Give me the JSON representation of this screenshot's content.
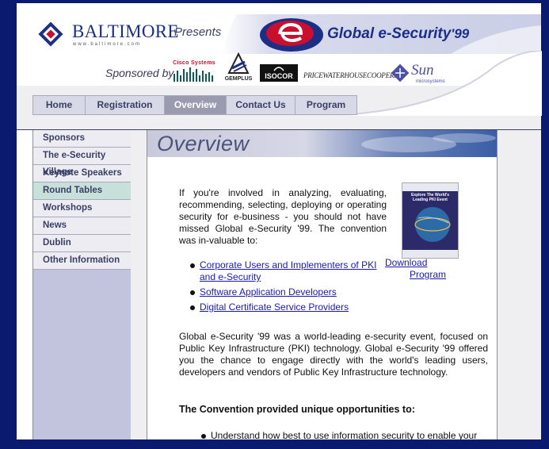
{
  "brand": {
    "name": "BALTIMORE",
    "url_text": "www.baltimore.com",
    "presents": "Presents",
    "event_title": "Global e-Security",
    "event_year": "'99",
    "brand_blue": "#1c2f86",
    "brand_red": "#c8102e"
  },
  "sponsors": {
    "label": "Sponsored by",
    "names": [
      "Cisco Systems",
      "GEMPLUS",
      "ISOCOR",
      "PRICEWATERHOUSECOOPERS",
      "Sun",
      "microsystems"
    ]
  },
  "nav": {
    "items": [
      {
        "label": "Home",
        "active": false
      },
      {
        "label": "Registration",
        "active": false
      },
      {
        "label": "Overview",
        "active": true
      },
      {
        "label": "Contact Us",
        "active": false
      },
      {
        "label": "Program",
        "active": false
      }
    ]
  },
  "sidebar": {
    "items": [
      {
        "label": "Sponsors"
      },
      {
        "label": "The e-Security Village"
      },
      {
        "label": "Keynote Speakers"
      },
      {
        "label": "Round Tables",
        "selected": true
      },
      {
        "label": "Workshops"
      },
      {
        "label": "News"
      },
      {
        "label": "Dublin"
      },
      {
        "label": "Other Information"
      }
    ]
  },
  "content": {
    "title": "Overview",
    "intro": "If you're involved in analyzing, evaluating, recommending, selecting, deploying or operating security for e-business - you should not have missed Global e-Security '99. The convention was in-valuable to:",
    "links": [
      "Corporate Users and Implementers of PKI and e-Security",
      "Software Application Developers",
      "Digital Certificate Service Providers"
    ],
    "download_line1": "Download",
    "download_line2": "Program",
    "book_text": "Explore The World's Leading PKI Event",
    "paragraph2": "Global e-Security '99 was a world-leading e-security event, focused on Public Key Infrastructure (PKI) technology. Global e-Security '99 offered you the chance to engage directly with the world's leading users, developers and vendors of Public Key Infrastructure technology.",
    "heading2": "The Convention provided unique opportunities to:",
    "bullet2": "Understand how best to use information security to enable your e-business activities"
  }
}
